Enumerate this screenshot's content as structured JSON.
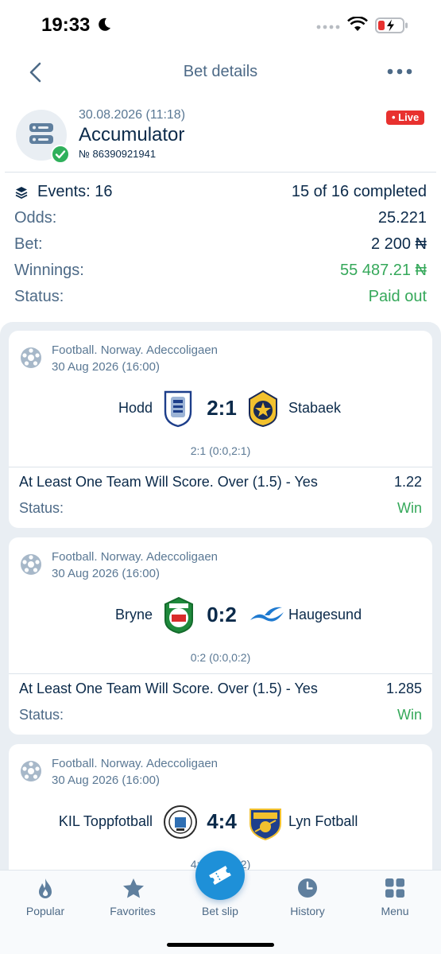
{
  "status_bar": {
    "time": "19:33"
  },
  "header": {
    "title": "Bet details"
  },
  "bet": {
    "date": "30.08.2026 (11:18)",
    "type": "Accumulator",
    "number": "№ 86390921941",
    "live_label": "• Live",
    "events_label": "Events: 16",
    "completed": "15 of 16 completed",
    "odds_label": "Odds:",
    "odds_value": "25.221",
    "bet_label": "Bet:",
    "bet_value": "2 200 ₦",
    "winnings_label": "Winnings:",
    "winnings_value": "55 487.21 ₦",
    "status_label": "Status:",
    "status_value": "Paid out"
  },
  "events": [
    {
      "league": "Football. Norway. Adeccoligaen",
      "date": "30 Aug 2026 (16:00)",
      "team1": "Hodd",
      "team2": "Stabaek",
      "score": "2:1",
      "halves": "2:1 (0:0,2:1)",
      "market": "At Least One Team Will Score. Over (1.5) - Yes",
      "odd": "1.22",
      "status_label": "Status:",
      "status": "Win"
    },
    {
      "league": "Football. Norway. Adeccoligaen",
      "date": "30 Aug 2026 (16:00)",
      "team1": "Bryne",
      "team2": "Haugesund",
      "score": "0:2",
      "halves": "0:2 (0:0,0:2)",
      "market": "At Least One Team Will Score. Over (1.5) - Yes",
      "odd": "1.285",
      "status_label": "Status:",
      "status": "Win"
    },
    {
      "league": "Football. Norway. Adeccoligaen",
      "date": "30 Aug 2026 (16:00)",
      "team1": "KIL Toppfotball",
      "team2": "Lyn Fotball",
      "score": "4:4",
      "halves": "4:4 (2:2,2:2)"
    }
  ],
  "nav": {
    "popular": "Popular",
    "favorites": "Favorites",
    "bet_slip": "Bet slip",
    "history": "History",
    "menu": "Menu"
  },
  "colors": {
    "accent": "#1e90d8",
    "win": "#35a85a",
    "live": "#e8312f",
    "text": "#0b2a4a",
    "muted": "#4d6a87"
  }
}
